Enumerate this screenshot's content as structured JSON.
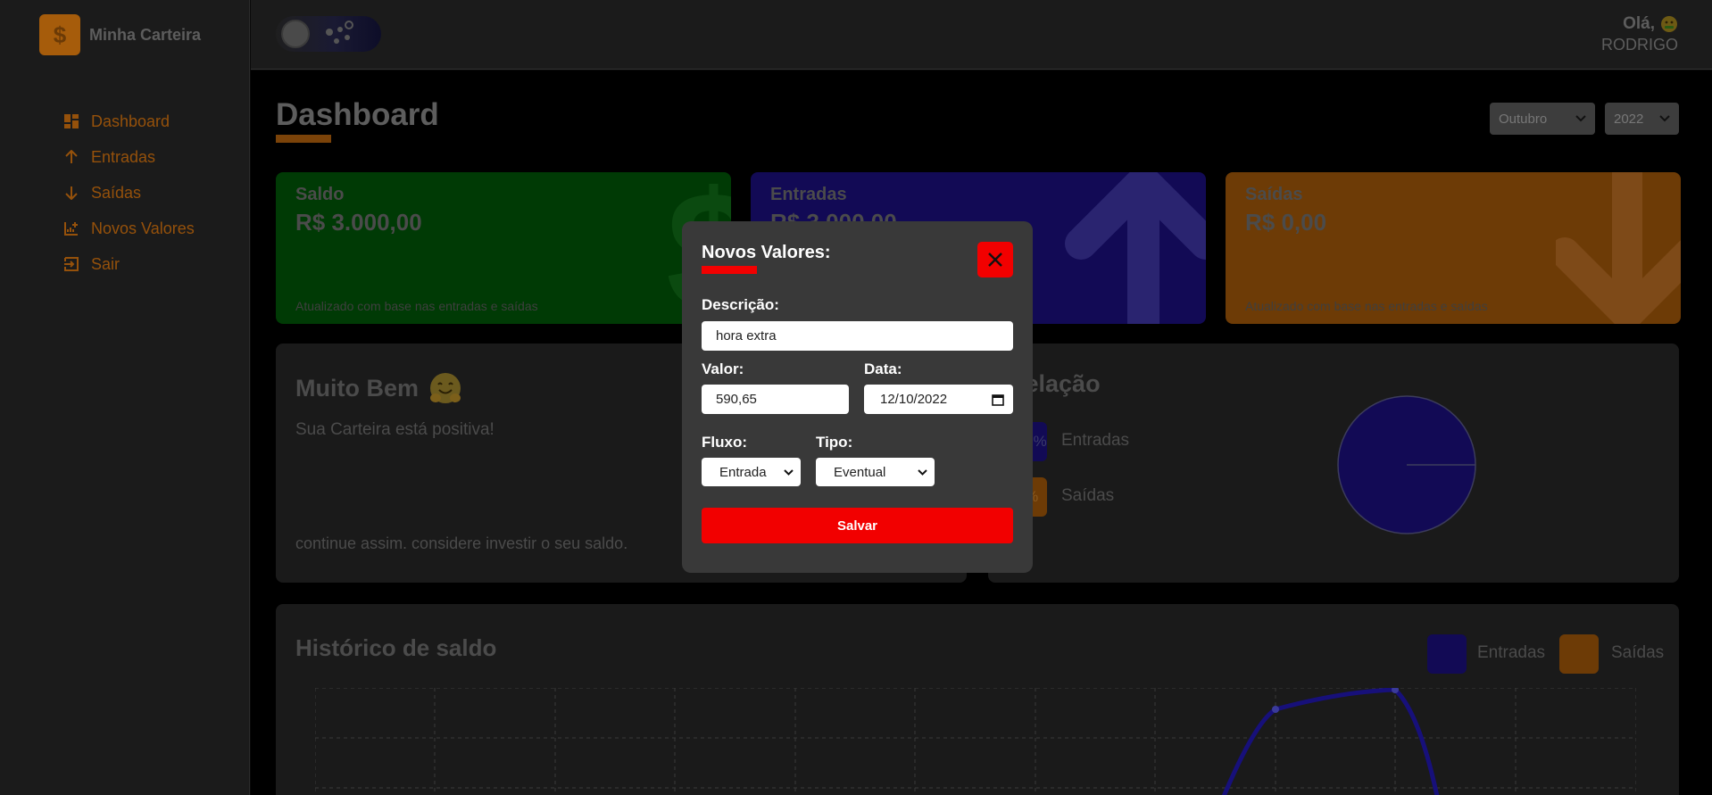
{
  "sidebar": {
    "brand_title": "Minha Carteira",
    "items": [
      {
        "label": "Dashboard",
        "icon": "dashboard-icon"
      },
      {
        "label": "Entradas",
        "icon": "arrow-up-icon"
      },
      {
        "label": "Saídas",
        "icon": "arrow-down-icon"
      },
      {
        "label": "Novos Valores",
        "icon": "chart-add-icon"
      },
      {
        "label": "Sair",
        "icon": "exit-icon"
      }
    ]
  },
  "header": {
    "greeting": "Olá,",
    "user": "RODRIGO"
  },
  "dashboard": {
    "title": "Dashboard",
    "month": "Outubro",
    "year": "2022"
  },
  "cards": [
    {
      "title": "Saldo",
      "value": "R$ 3.000,00",
      "note": "Atualizado com base nas entradas e saídas",
      "color": "#003a05"
    },
    {
      "title": "Entradas",
      "value": "R$ 3.000,00",
      "note": "",
      "color": "#120a55"
    },
    {
      "title": "Saídas",
      "value": "R$ 0,00",
      "note": "Atualizado com base nas entradas e saídas",
      "color": "#6d3b06"
    }
  ],
  "message_panel": {
    "title": "Muito Bem",
    "text": "Sua Carteira está positiva!",
    "footer": "continue assim. considere investir o seu saldo."
  },
  "relation_panel": {
    "title": "Relação",
    "items": [
      {
        "label": "Entradas",
        "percent": "100%",
        "color": "#120a55"
      },
      {
        "label": "Saídas",
        "percent": "0%",
        "color": "#6d3b06"
      }
    ]
  },
  "history_panel": {
    "title": "Histórico de saldo",
    "legend": [
      {
        "label": "Entradas",
        "color": "#120a55"
      },
      {
        "label": "Saídas",
        "color": "#6d3b06"
      }
    ]
  },
  "modal": {
    "title": "Novos Valores:",
    "description_label": "Descrição:",
    "description_value": "hora extra",
    "value_label": "Valor:",
    "value_value": "590,65",
    "date_label": "Data:",
    "date_value": "12/10/2022",
    "flow_label": "Fluxo:",
    "flow_value": "Entrada",
    "type_label": "Tipo:",
    "type_value": "Eventual",
    "save_label": "Salvar"
  },
  "colors": {
    "accent": "#f20000",
    "brand": "#a65c0b"
  }
}
